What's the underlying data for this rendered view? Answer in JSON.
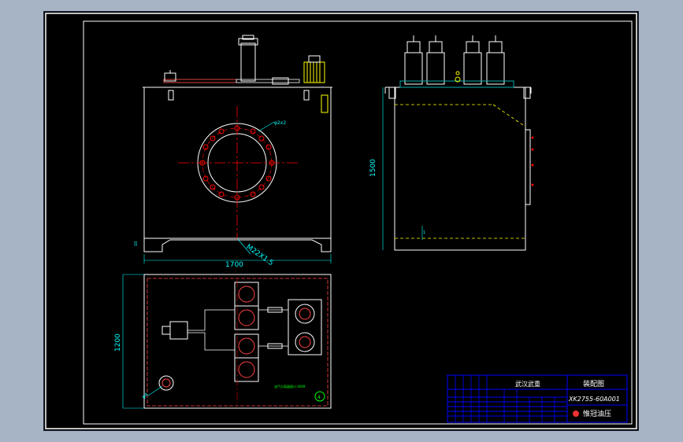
{
  "drawing": {
    "dim_width": "1700",
    "dim_height": "1500",
    "dim_depth": "1200",
    "flange_note": "φ2x2",
    "port_note": "M22X1.5",
    "level_mark": "1",
    "small_label_left": "10",
    "small_label_plan": "φ4",
    "plan_caption": "油气分离器接口 4009",
    "plan_badge": "4"
  },
  "title_block": {
    "col1_heading": "武汉武重",
    "drawing_title": "装配图",
    "drawing_number": "XK2755-60A001",
    "company": "惟冠油压"
  },
  "colors": {
    "background": "#000000",
    "frame": "#ffffff",
    "center_line": "#ff0000",
    "dimension": "#00ffff",
    "hidden_line": "#ffff00",
    "tank_outline": "#ffffff"
  }
}
